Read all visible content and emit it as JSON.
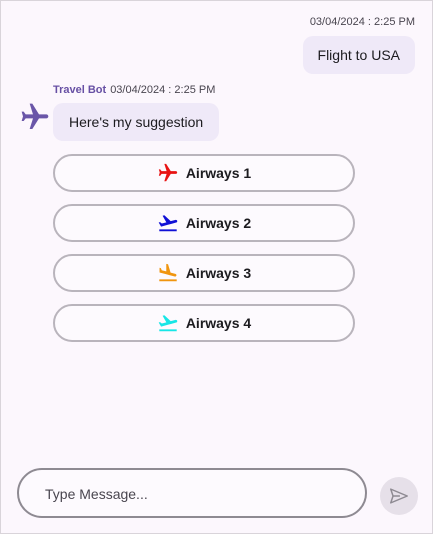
{
  "user_message": {
    "timestamp": "03/04/2024 : 2:25 PM",
    "text": "Flight to USA"
  },
  "bot_message": {
    "author": "Travel Bot",
    "timestamp": "03/04/2024 : 2:25 PM",
    "avatar_icon": "airplane-icon",
    "text": "Here's my suggestion"
  },
  "suggestions": [
    {
      "label": "Airways 1",
      "icon": "airplane-icon",
      "color": "#e81313"
    },
    {
      "label": "Airways 2",
      "icon": "flight-takeoff-icon",
      "color": "#1010d6"
    },
    {
      "label": "Airways 3",
      "icon": "flight-land-icon",
      "color": "#f0950f"
    },
    {
      "label": "Airways 4",
      "icon": "flight-takeoff-icon",
      "color": "#17e6e6"
    }
  ],
  "composer": {
    "placeholder": "Type Message...",
    "send_icon": "send-icon"
  },
  "colors": {
    "background": "#fcf7fd",
    "bubble": "#efe9f8",
    "accent": "#6750a4"
  }
}
